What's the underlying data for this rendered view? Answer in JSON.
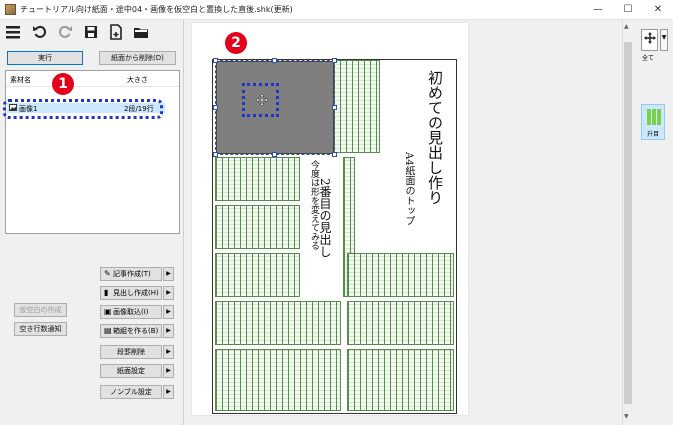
{
  "window": {
    "title": "チュートリアル向け紙面・途中04・画像を仮空白と置換した直後.shk(更新)",
    "minimize_glyph": "—",
    "maximize_glyph": "☐",
    "close_glyph": "✕"
  },
  "toolbar": {
    "icons": [
      "menu-icon",
      "undo-icon",
      "redo-icon",
      "save-icon",
      "new-document-icon",
      "folder-icon"
    ]
  },
  "actions": {
    "execute_label": "実行",
    "remove_from_page_label": "紙面から削除(D)"
  },
  "asset_list": {
    "columns": [
      "素材名",
      "大きさ"
    ],
    "rows": [
      {
        "name": "画像1",
        "size": "2段/19行"
      }
    ]
  },
  "badges": {
    "one": "1",
    "two": "2"
  },
  "left_buttons": {
    "temp_blank": "仮空白の作成",
    "free_lines": "空き行数通知"
  },
  "side_menu": [
    {
      "icon": "pencil-icon",
      "glyph": "✎",
      "label": "記事作成(T)"
    },
    {
      "icon": "headline-icon",
      "glyph": "▮",
      "label": "見出し作成(H)"
    },
    {
      "icon": "image-import-icon",
      "glyph": "▣",
      "label": "画像取込(I)"
    },
    {
      "icon": "box-icon",
      "glyph": "▤",
      "label": "箱組を作る(B)"
    },
    {
      "icon": "",
      "glyph": "",
      "label": "段罫削除"
    },
    {
      "icon": "",
      "glyph": "",
      "label": "紙面設定"
    },
    {
      "icon": "",
      "glyph": "",
      "label": "ノンブル設定"
    }
  ],
  "side_arrow": "▶",
  "page": {
    "headline_main": "初めての見出し作り",
    "headline_sub": "A4紙面のトップ",
    "second_headline": "2番目の見出し",
    "second_sub": "今度は形を変えてみる"
  },
  "right_panel": {
    "view_label": "全て",
    "column_label": "升目"
  },
  "colors": {
    "highlight": "#1f36c7",
    "badge": "#e4001b",
    "grid_green": "#5a8a4e",
    "image_gray": "#7f7f7f"
  }
}
